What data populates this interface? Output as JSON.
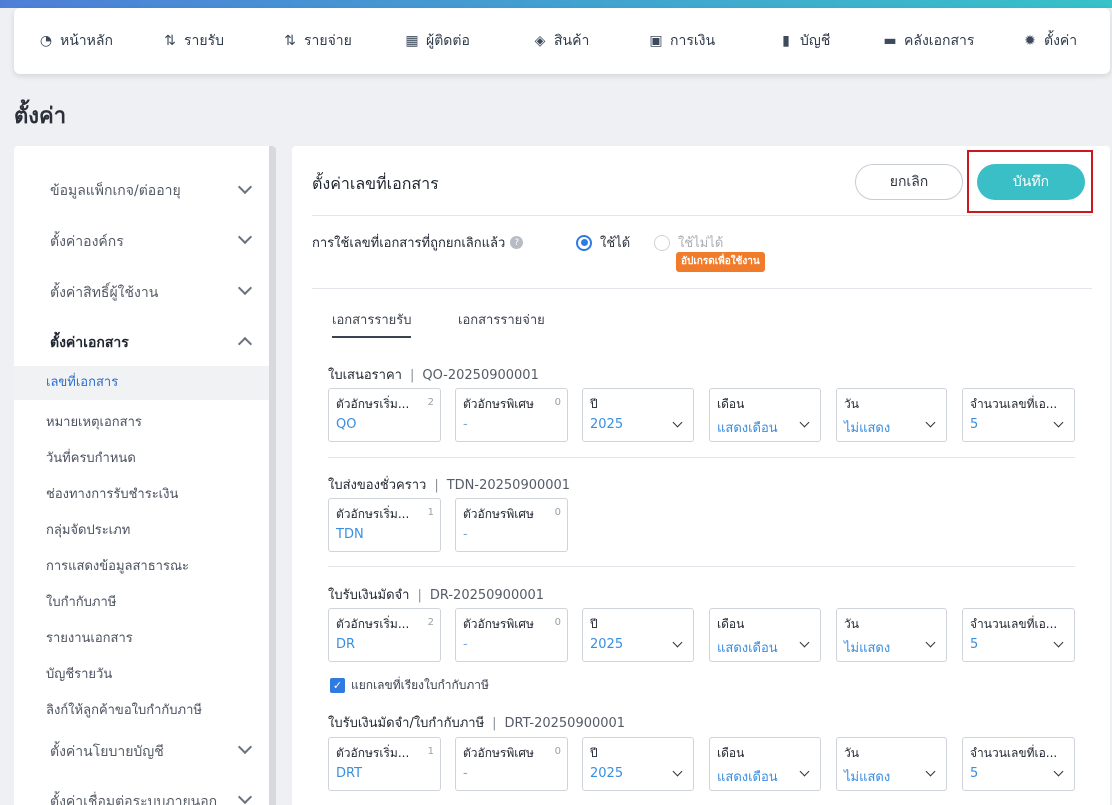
{
  "nav": [
    {
      "icon": "dashboard-icon",
      "glyph": "◔",
      "label": "หน้าหลัก"
    },
    {
      "icon": "income-icon",
      "glyph": "⇅",
      "label": "รายรับ"
    },
    {
      "icon": "expense-icon",
      "glyph": "⇅",
      "label": "รายจ่าย"
    },
    {
      "icon": "contacts-icon",
      "glyph": "▦",
      "label": "ผู้ติดต่อ"
    },
    {
      "icon": "product-icon",
      "glyph": "◈",
      "label": "สินค้า"
    },
    {
      "icon": "finance-icon",
      "glyph": "▣",
      "label": "การเงิน"
    },
    {
      "icon": "accounting-icon",
      "glyph": "▮",
      "label": "บัญชี"
    },
    {
      "icon": "folder-icon",
      "glyph": "▬",
      "label": "คลังเอกสาร"
    },
    {
      "icon": "gear-icon",
      "glyph": "✹",
      "label": "ตั้งค่า"
    }
  ],
  "page_title": "ตั้งค่า",
  "sidebar": {
    "groups": [
      {
        "label": "ข้อมูลแพ็กเกจ/ต่ออายุ"
      },
      {
        "label": "ตั้งค่าองค์กร"
      },
      {
        "label": "ตั้งค่าสิทธิ์ผู้ใช้งาน"
      },
      {
        "label": "ตั้งค่าเอกสาร"
      },
      {
        "label": "ตั้งค่านโยบายบัญชี"
      },
      {
        "label": "ตั้งค่าเชื่อมต่อระบบภายนอก"
      }
    ],
    "subitems": [
      "เลขที่เอกสาร",
      "หมายเหตุเอกสาร",
      "วันที่ครบกำหนด",
      "ช่องทางการรับชำระเงิน",
      "กลุ่มจัดประเภท",
      "การแสดงข้อมูลสาธารณะ",
      "ใบกำกับภาษี",
      "รายงานเอกสาร",
      "บัญชีรายวัน",
      "ลิงก์ให้ลูกค้าขอใบกำกับภาษี"
    ]
  },
  "panel": {
    "title": "ตั้งค่าเลขที่เอกสาร",
    "cancel_label": "ยกเลิก",
    "save_label": "บันทึก",
    "question": "การใช้เลขที่เอกสารที่ถูกยกเลิกแล้ว",
    "radio_on": "ใช้ได้",
    "radio_off": "ใช้ไม่ได้",
    "upgrade_badge": "อัปเกรดเพื่อใช้งาน",
    "tabs": [
      "เอกสารรายรับ",
      "เอกสารรายจ่าย"
    ],
    "docs": [
      {
        "name": "ใบเสนอราคา",
        "code": "QO-20250900001",
        "prefix": "QO",
        "prefix_count": "2",
        "special": "-",
        "special_count": "0",
        "year": "2025",
        "month": "แสดงเดือน",
        "day": "ไม่แสดง",
        "digits": "5"
      },
      {
        "name": "ใบส่งของชั่วคราว",
        "code": "TDN-20250900001",
        "prefix": "TDN",
        "prefix_count": "1",
        "special": "-",
        "special_count": "0"
      },
      {
        "name": "ใบรับเงินมัดจำ",
        "code": "DR-20250900001",
        "prefix": "DR",
        "prefix_count": "2",
        "special": "-",
        "special_count": "0",
        "year": "2025",
        "month": "แสดงเดือน",
        "day": "ไม่แสดง",
        "digits": "5"
      },
      {
        "name": "ใบรับเงินมัดจำ/ใบกำกับภาษี",
        "code": "DRT-20250900001",
        "prefix": "DRT",
        "prefix_count": "1",
        "special": "-",
        "special_count": "0",
        "year": "2025",
        "month": "แสดงเดือน",
        "day": "ไม่แสดง",
        "digits": "5"
      }
    ],
    "field_labels": {
      "prefix": "ตัวอักษรเริ่ม...",
      "special": "ตัวอักษรพิเศษ",
      "year": "ปี",
      "month": "เดือน",
      "day": "วัน",
      "digits": "จำนวนเลขที่เอ..."
    },
    "checkbox_label": "แยกเลขที่เรียงใบกำกับภาษี"
  },
  "colors": {
    "accent": "#3bbfc6",
    "link": "#3a8ee0",
    "highlight": "#d0161d",
    "upgrade": "#f07b2a"
  }
}
